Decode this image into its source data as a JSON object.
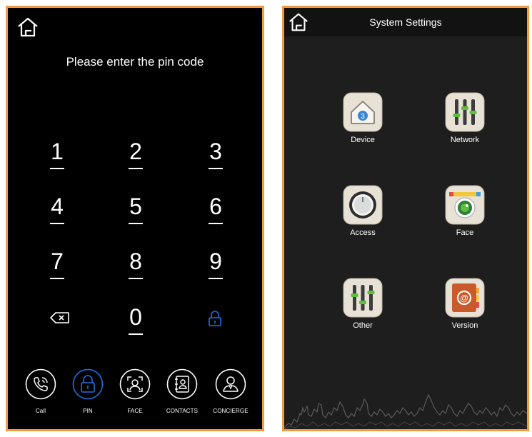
{
  "pin_screen": {
    "title": "Please enter the pin code",
    "keys": [
      "1",
      "2",
      "3",
      "4",
      "5",
      "6",
      "7",
      "8",
      "9",
      "0"
    ],
    "backspace_icon": "backspace-icon",
    "unlock_icon": "lock-icon",
    "nav": [
      {
        "label": "Call",
        "icon": "phone-icon"
      },
      {
        "label": "PIN",
        "icon": "lock-icon",
        "active": true
      },
      {
        "label": "FACE",
        "icon": "face-scan-icon"
      },
      {
        "label": "CONTACTS",
        "icon": "contacts-icon"
      },
      {
        "label": "CONCIERGE",
        "icon": "concierge-icon"
      }
    ]
  },
  "settings_screen": {
    "title": "System Settings",
    "items": [
      {
        "label": "Device",
        "icon": "device-icon",
        "badge": "3"
      },
      {
        "label": "Network",
        "icon": "network-icon"
      },
      {
        "label": "Access",
        "icon": "access-icon"
      },
      {
        "label": "Face",
        "icon": "face-camera-icon"
      },
      {
        "label": "Other",
        "icon": "other-icon"
      },
      {
        "label": "Version",
        "icon": "version-icon"
      }
    ]
  },
  "colors": {
    "border": "#f39a3e",
    "accent_blue": "#1f6fe5",
    "pin_background": "#000000",
    "settings_background": "#1e1e1e"
  }
}
